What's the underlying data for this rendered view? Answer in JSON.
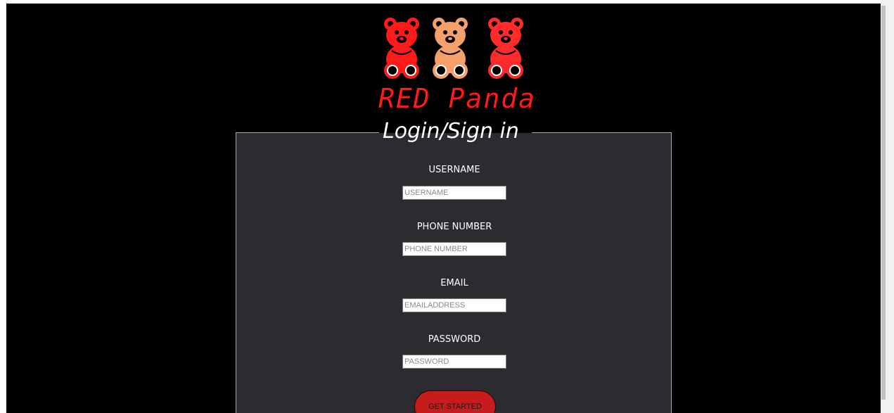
{
  "brand": {
    "name": "RED Panda",
    "logo_icon": "teddy-bears-icon",
    "colors": {
      "bear_left": "#ff1a1a",
      "bear_middle": "#f5a06b",
      "bear_right": "#ff2b2b",
      "text": "#ff1a1a"
    }
  },
  "form": {
    "legend": "Login/Sign in",
    "fields": [
      {
        "label": "USERNAME",
        "placeholder": "USERNAME",
        "value": ""
      },
      {
        "label": "PHONE NUMBER",
        "placeholder": "PHONE NUMBER",
        "value": ""
      },
      {
        "label": "EMAIL",
        "placeholder": "EMAILADDRESS",
        "value": ""
      },
      {
        "label": "PASSWORD",
        "placeholder": "PASSWORD",
        "value": ""
      }
    ],
    "submit_label": "GET STARTED"
  },
  "colors": {
    "page_background": "#000000",
    "panel_background": "#2c2c30",
    "button": "#c81b1b"
  }
}
